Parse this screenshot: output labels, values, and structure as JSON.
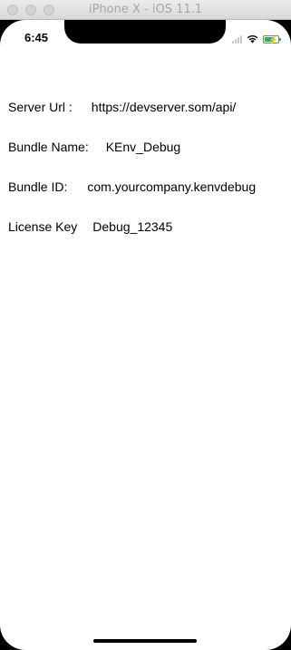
{
  "window": {
    "title": "iPhone X - iOS 11.1"
  },
  "status_bar": {
    "time": "6:45",
    "icons": [
      "signal-icon",
      "wifi-icon",
      "battery-charging-icon"
    ],
    "battery_level": 0.8,
    "battery_color": "#2ab34a"
  },
  "config": {
    "rows": [
      {
        "label": "Server Url :",
        "value": "https://devserver.som/api/"
      },
      {
        "label": "Bundle Name:",
        "value": "KEnv_Debug"
      },
      {
        "label": "Bundle ID:",
        "value": "com.yourcompany.kenvdebug"
      },
      {
        "label": "License Key",
        "value": "Debug_12345"
      }
    ]
  }
}
